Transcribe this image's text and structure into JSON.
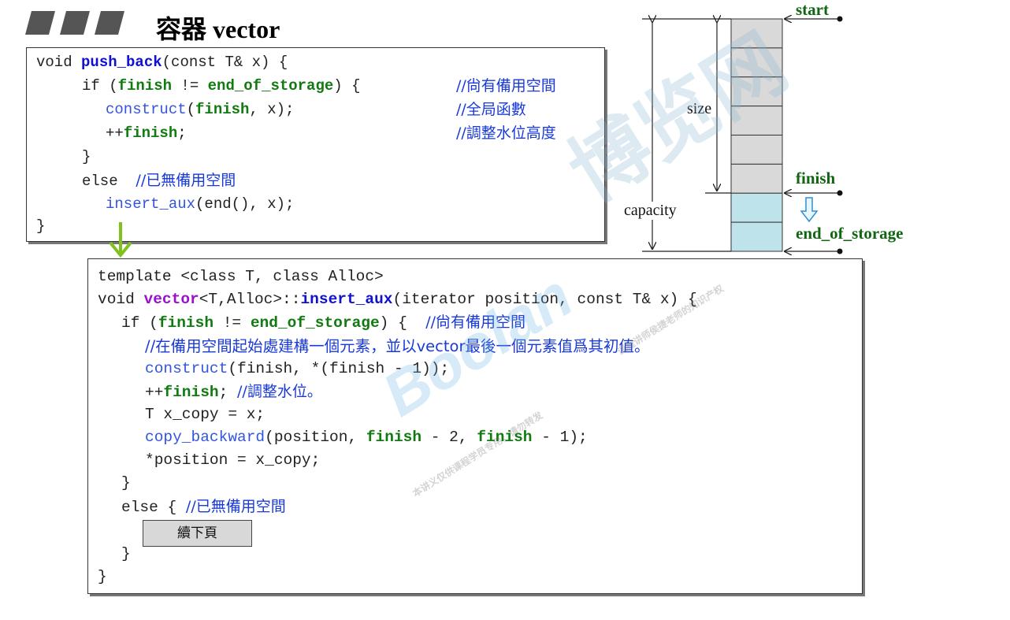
{
  "slide": {
    "title": "容器 vector"
  },
  "push_back_box": {
    "lines": [
      [
        "void ",
        "push_back",
        "(const T& x) {"
      ],
      [
        "if (",
        "finish",
        " != ",
        "end_of_storage",
        ") { ",
        "//尙有備用空間"
      ],
      [
        "construct",
        "(",
        "finish",
        ", x);",
        "//全局函數"
      ],
      [
        "++",
        "finish",
        ";",
        "//調整水位高度"
      ],
      [
        "}"
      ],
      [
        "else  ",
        "//已無備用空間"
      ],
      [
        "insert_aux",
        "(end(), x);"
      ],
      [
        "}"
      ]
    ]
  },
  "insert_aux_box": {
    "lines": [
      [
        "template <class T, class Alloc>"
      ],
      [
        "void ",
        "vector",
        "<T,Alloc>::",
        "insert_aux",
        "(iterator position, const T& x) {"
      ],
      [
        "if (",
        "finish",
        " != ",
        "end_of_storage",
        ") {  ",
        "//尙有備用空間"
      ],
      [
        "//在備用空間起始處建構一個元素，並以vector最後一個元素值爲其初值。"
      ],
      [
        "construct",
        "(finish, *(finish - 1));"
      ],
      [
        "++",
        "finish",
        "; ",
        "//調整水位。"
      ],
      [
        "T x_copy = x;"
      ],
      [
        "copy_backward",
        "(position, ",
        "finish",
        " - 2, ",
        "finish",
        " - 1);"
      ],
      [
        "*position = x_copy;"
      ],
      [
        "}"
      ],
      [
        "else { ",
        "//已無備用空間"
      ],
      [
        "}"
      ],
      [
        "}"
      ]
    ],
    "next_page_button": "續下頁"
  },
  "diagram": {
    "labels": {
      "start": "start",
      "finish": "finish",
      "end_of_storage": "end_of_storage",
      "size": "size",
      "capacity": "capacity"
    },
    "used_cells": 6,
    "spare_cells": 2,
    "colors": {
      "used": "#d9d9d9",
      "spare": "#bfe3ea",
      "label_green": "#116611",
      "arrow_green": "#7fc21f"
    }
  },
  "watermark": {
    "main": "博览网",
    "logo": "Boolan",
    "line1": "本讲义仅供课程学员专用，请勿转发",
    "line2": "课程讲师侯捷老师的知识产权"
  }
}
